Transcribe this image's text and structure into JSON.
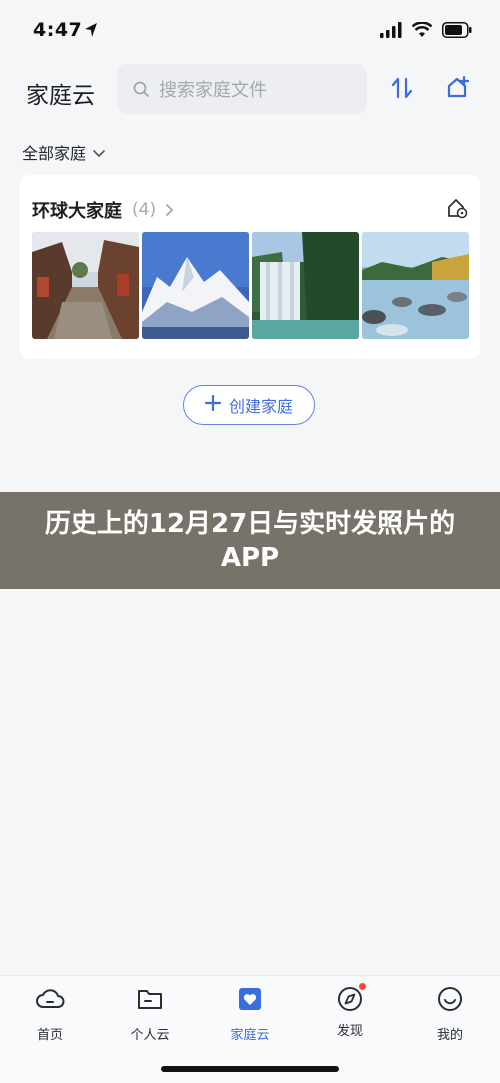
{
  "status": {
    "time": "4:47"
  },
  "header": {
    "title": "家庭云",
    "search_placeholder": "搜索家庭文件"
  },
  "family_selector": {
    "label": "全部家庭"
  },
  "family_card": {
    "name": "环球大家庭",
    "count": "(4)",
    "photos": [
      "old-town-street",
      "snow-mountain",
      "waterfall",
      "lake-rocks"
    ]
  },
  "create_button": {
    "label": "创建家庭"
  },
  "banner": {
    "text": "历史上的12月27日与实时发照片的APP"
  },
  "tabbar": {
    "tabs": [
      {
        "label": "首页",
        "icon": "cloud-icon"
      },
      {
        "label": "个人云",
        "icon": "folder-icon"
      },
      {
        "label": "家庭云",
        "icon": "family-cloud-icon",
        "active": true
      },
      {
        "label": "发现",
        "icon": "compass-icon",
        "badge": true
      },
      {
        "label": "我的",
        "icon": "smile-icon"
      }
    ]
  },
  "colors": {
    "accent": "#3a6ee0",
    "badge": "#f04a3e",
    "banner": "#77736a"
  }
}
